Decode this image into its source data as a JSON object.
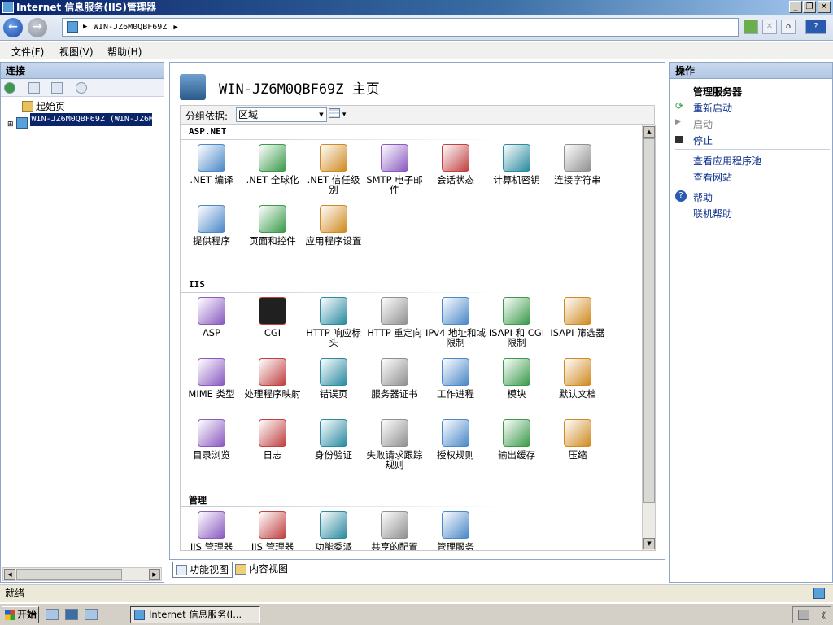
{
  "window": {
    "title": "Internet 信息服务(IIS)管理器"
  },
  "address": {
    "path": "WIN-JZ6M0QBF69Z"
  },
  "menu": [
    "文件(F)",
    "视图(V)",
    "帮助(H)"
  ],
  "left_pane": {
    "header": "连接",
    "tree": [
      {
        "label": "起始页"
      },
      {
        "label": "WIN-JZ6M0QBF69Z (WIN-JZ6M0",
        "selected": true
      }
    ]
  },
  "center": {
    "title": "WIN-JZ6M0QBF69Z 主页",
    "group_by_label": "分组依据:",
    "group_by_value": "区域",
    "sections": [
      {
        "name": "ASP.NET",
        "items": [
          ".NET 编译",
          ".NET 全球化",
          ".NET 信任级别",
          "SMTP 电子邮件",
          "会话状态",
          "计算机密钥",
          "连接字符串",
          "提供程序",
          "页面和控件",
          "应用程序设置"
        ]
      },
      {
        "name": "IIS",
        "items": [
          "ASP",
          "CGI",
          "HTTP 响应标头",
          "HTTP 重定向",
          "IPv4 地址和域限制",
          "ISAPI 和 CGI 限制",
          "ISAPI 筛选器",
          "MIME 类型",
          "处理程序映射",
          "错误页",
          "服务器证书",
          "工作进程",
          "模块",
          "默认文档",
          "目录浏览",
          "日志",
          "身份验证",
          "失败请求跟踪规则",
          "授权规则",
          "输出缓存",
          "压缩"
        ]
      },
      {
        "name": "管理",
        "items": [
          "IIS 管理器",
          "IIS 管理器",
          "功能委派",
          "共享的配置",
          "管理服务"
        ]
      }
    ],
    "icon_colors": [
      "#4a88c8",
      "#3a9a4a",
      "#d08a20",
      "#8a5ac0",
      "#c04040",
      "#2a8aa0",
      "#909090"
    ]
  },
  "view_tabs": [
    "功能视图",
    "内容视图"
  ],
  "right_pane": {
    "header": "操作",
    "groups": [
      {
        "items": [
          {
            "label": "管理服务器",
            "kind": "group"
          },
          {
            "label": "重新启动",
            "icon": "restart-icon"
          },
          {
            "label": "启动",
            "icon": "start-icon",
            "disabled": true
          },
          {
            "label": "停止",
            "icon": "stop-icon"
          }
        ]
      },
      {
        "items": [
          {
            "label": "查看应用程序池"
          },
          {
            "label": "查看网站"
          }
        ]
      },
      {
        "items": [
          {
            "label": "帮助",
            "icon": "help-icon"
          },
          {
            "label": "联机帮助"
          }
        ]
      }
    ]
  },
  "status": {
    "text": "就绪"
  },
  "taskbar": {
    "start": "开始",
    "item": "Internet 信息服务(I..."
  }
}
